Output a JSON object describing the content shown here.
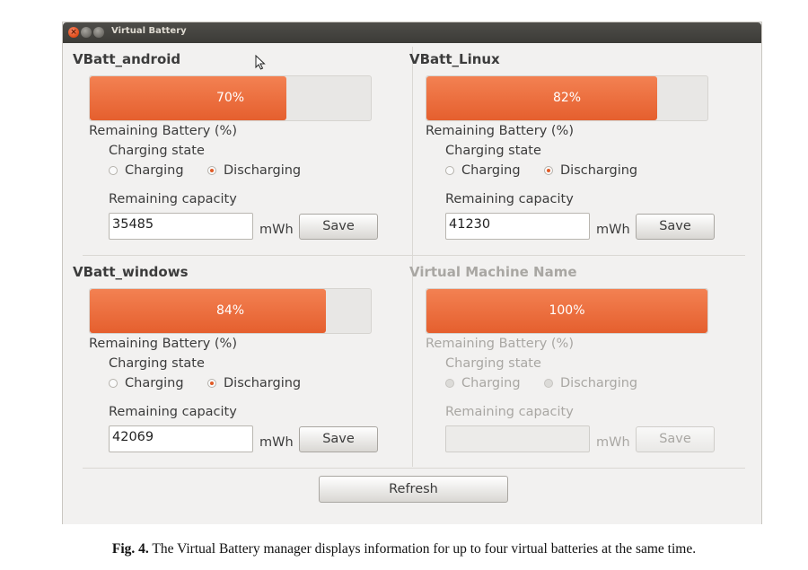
{
  "window": {
    "title": "Virtual Battery"
  },
  "batteries": [
    {
      "name": "VBatt_android",
      "level_percent": 70,
      "level_label": "70%",
      "remaining_label": "Remaining Battery (%)",
      "charging_state_label": "Charging state",
      "option_charging": "Charging",
      "option_discharging": "Discharging",
      "selected": "discharging",
      "capacity_label": "Remaining capacity",
      "capacity_value": "35485",
      "unit": "mWh",
      "save_label": "Save"
    },
    {
      "name": "VBatt_Linux",
      "level_percent": 82,
      "level_label": "82%",
      "remaining_label": "Remaining Battery (%)",
      "charging_state_label": "Charging state",
      "option_charging": "Charging",
      "option_discharging": "Discharging",
      "selected": "discharging",
      "capacity_label": "Remaining capacity",
      "capacity_value": "41230",
      "unit": "mWh",
      "save_label": "Save"
    },
    {
      "name": "VBatt_windows",
      "level_percent": 84,
      "level_label": "84%",
      "remaining_label": "Remaining Battery (%)",
      "charging_state_label": "Charging state",
      "option_charging": "Charging",
      "option_discharging": "Discharging",
      "selected": "discharging",
      "capacity_label": "Remaining capacity",
      "capacity_value": "42069",
      "unit": "mWh",
      "save_label": "Save"
    },
    {
      "name": "Virtual Machine Name",
      "level_percent": 100,
      "level_label": "100%",
      "remaining_label": "Remaining Battery (%)",
      "charging_state_label": "Charging state",
      "option_charging": "Charging",
      "option_discharging": "Discharging",
      "selected": "none",
      "capacity_label": "Remaining capacity",
      "capacity_value": "",
      "unit": "mWh",
      "save_label": "Save",
      "disabled": true
    }
  ],
  "refresh_label": "Refresh",
  "caption": {
    "label": "Fig. 4.",
    "text": "The Virtual Battery manager displays information for up to four virtual batteries at the same time."
  },
  "colors": {
    "accent": "#e9693a",
    "titlebar": "#3c3b37",
    "window_bg": "#f2f1f0"
  }
}
